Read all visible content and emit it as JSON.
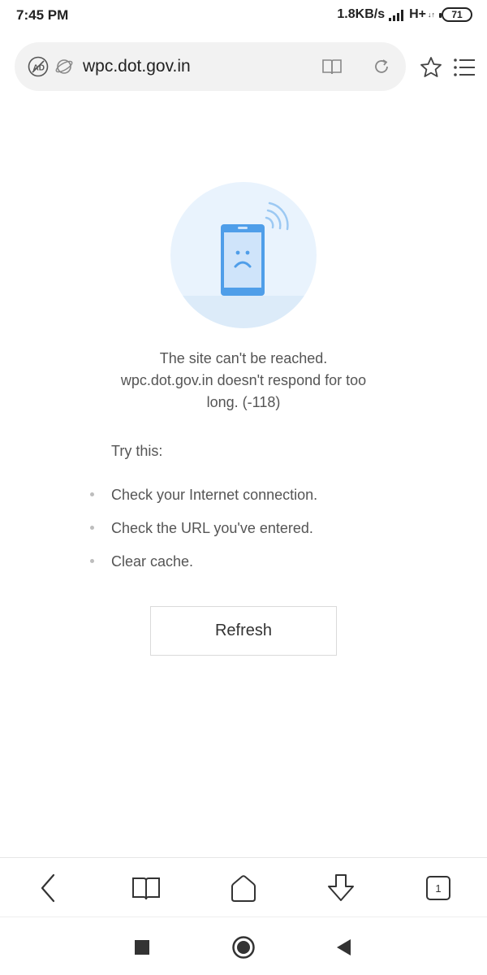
{
  "status_bar": {
    "time": "7:45 PM",
    "net_speed": "1.8KB/s",
    "network_type": "H+",
    "network_arrows": "↓↑",
    "battery": "71",
    "icons": [
      "signal-icon",
      "battery-icon"
    ]
  },
  "address_bar": {
    "url": "wpc.dot.gov.in",
    "icons": [
      "adblock-icon",
      "planet-icon",
      "reader-mode-icon",
      "reload-icon",
      "star-icon",
      "menu-icon"
    ]
  },
  "error": {
    "title": "The site can't be reached.",
    "detail": "wpc.dot.gov.in doesn't respond for too long. (-118)"
  },
  "suggestions": {
    "heading": "Try this:",
    "items": [
      "Check your Internet connection.",
      "Check the URL you've entered.",
      "Clear cache."
    ]
  },
  "refresh_label": "Refresh",
  "toolbar": {
    "tab_count": "1",
    "icons": [
      "back-icon",
      "bookmarks-icon",
      "home-icon",
      "download-icon",
      "tabs-icon"
    ]
  },
  "nav_bar": {
    "icons": [
      "recents-icon",
      "home-circle-icon",
      "back-triangle-icon"
    ]
  },
  "colors": {
    "illustration_bg": "#e9f3fd",
    "phone_blue": "#4f9ee9",
    "text_gray": "#555555"
  }
}
